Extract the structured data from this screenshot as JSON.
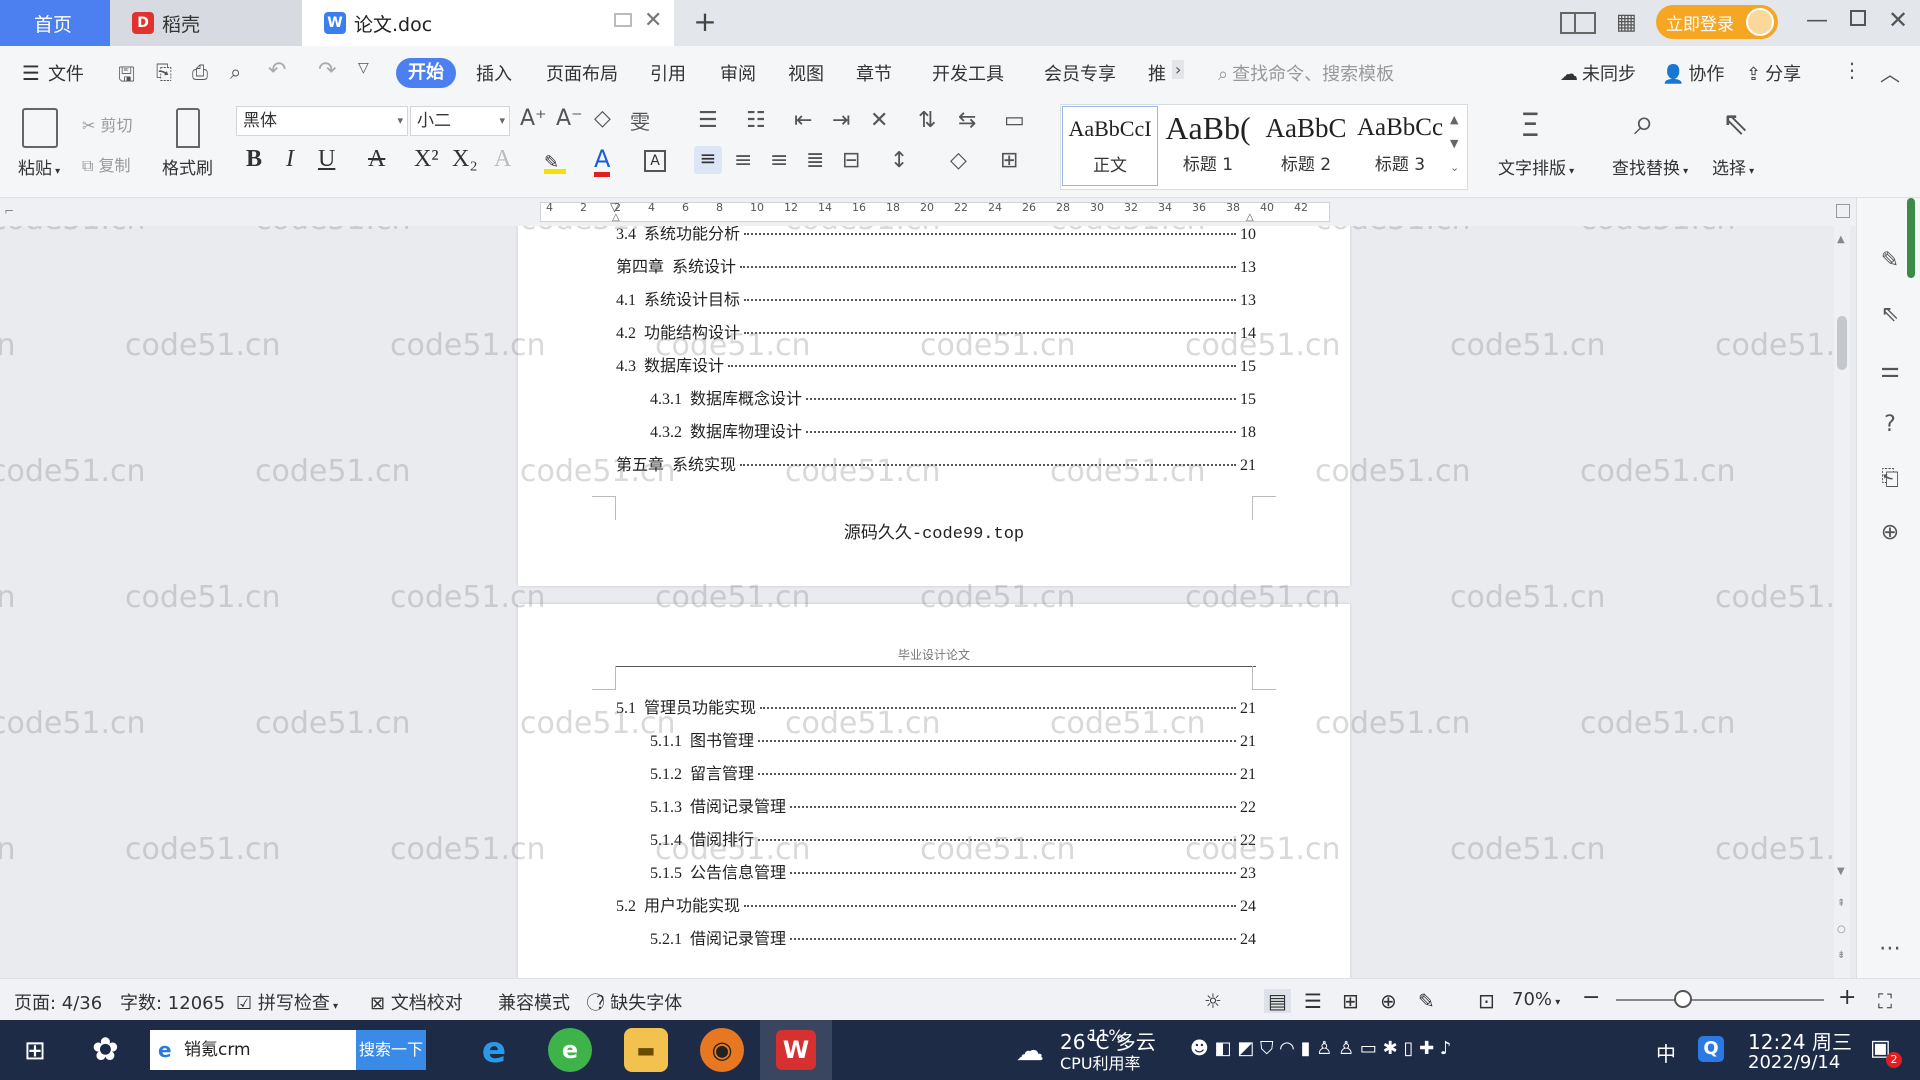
{
  "tabs": {
    "home": "首页",
    "daoke": "稻壳",
    "doc": "论文.doc"
  },
  "titlebar": {
    "login": "立即登录"
  },
  "menu": {
    "file": "文件",
    "start": "开始",
    "insert": "插入",
    "layout": "页面布局",
    "reference": "引用",
    "review": "审阅",
    "view": "视图",
    "chapter": "章节",
    "devtools": "开发工具",
    "member": "会员专享",
    "recommend": "推",
    "search_placeholder": "查找命令、搜索模板",
    "unsynced": "未同步",
    "collab": "协作",
    "share": "分享"
  },
  "ribbon": {
    "paste": "粘贴",
    "cut": "剪切",
    "copy": "复制",
    "format_painter": "格式刷",
    "font_family": "黑体",
    "font_size": "小二",
    "styles": [
      {
        "preview": "AaBbCcI",
        "name": "正文"
      },
      {
        "preview": "AaBb(",
        "name": "标题 1"
      },
      {
        "preview": "AaBbC",
        "name": "标题 2"
      },
      {
        "preview": "AaBbCc",
        "name": "标题 3"
      }
    ],
    "text_layout": "文字排版",
    "find_replace": "查找替换",
    "select": "选择"
  },
  "ruler": {
    "ticks": [
      "4",
      "2",
      "2",
      "4",
      "6",
      "8",
      "10",
      "12",
      "14",
      "16",
      "18",
      "20",
      "22",
      "24",
      "26",
      "28",
      "30",
      "32",
      "34",
      "36",
      "38",
      "40",
      "42"
    ]
  },
  "page1": {
    "toc": [
      {
        "num": "3.4",
        "title": "系统功能分析",
        "page": "10",
        "level": 1
      },
      {
        "num": "第四章",
        "title": "系统设计",
        "page": "13",
        "level": 1
      },
      {
        "num": "4.1",
        "title": "系统设计目标",
        "page": "13",
        "level": 1
      },
      {
        "num": "4.2",
        "title": "功能结构设计",
        "page": "14",
        "level": 1
      },
      {
        "num": "4.3",
        "title": "数据库设计",
        "page": "15",
        "level": 1
      },
      {
        "num": "4.3.1",
        "title": "数据库概念设计",
        "page": "15",
        "level": 2
      },
      {
        "num": "4.3.2",
        "title": "数据库物理设计",
        "page": "18",
        "level": 2
      },
      {
        "num": "第五章",
        "title": "系统实现",
        "page": "21",
        "level": 1
      }
    ],
    "footer": "源码久久-code99.top"
  },
  "page2": {
    "header": "毕业设计论文",
    "toc": [
      {
        "num": "5.1",
        "title": "管理员功能实现",
        "page": "21",
        "level": 1
      },
      {
        "num": "5.1.1",
        "title": "图书管理",
        "page": "21",
        "level": 2
      },
      {
        "num": "5.1.2",
        "title": "留言管理",
        "page": "21",
        "level": 2
      },
      {
        "num": "5.1.3",
        "title": "借阅记录管理",
        "page": "22",
        "level": 2
      },
      {
        "num": "5.1.4",
        "title": "借阅排行",
        "page": "22",
        "level": 2
      },
      {
        "num": "5.1.5",
        "title": "公告信息管理",
        "page": "23",
        "level": 2
      },
      {
        "num": "5.2",
        "title": "用户功能实现",
        "page": "24",
        "level": 1
      },
      {
        "num": "5.2.1",
        "title": "借阅记录管理",
        "page": "24",
        "level": 2
      }
    ]
  },
  "watermark": "code51.cn",
  "statusbar": {
    "page": "页面: 4/36",
    "words": "字数: 12065",
    "spellcheck": "拼写检查",
    "doc_check": "文档校对",
    "compat": "兼容模式",
    "missing_font": "缺失字体",
    "zoom": "70%"
  },
  "taskbar": {
    "search_value": "销氪crm",
    "search_btn": "搜索一下",
    "weather": "26°C 多云",
    "cpu_percent": "11%",
    "cpu_label": "CPU利用率",
    "ime": "中",
    "time": "12:24 周三",
    "date": "2022/9/14",
    "notif_count": "2"
  },
  "colors": {
    "accent": "#4c7ff0",
    "login": "#f5a623",
    "taskbar": "#1d2b47"
  }
}
